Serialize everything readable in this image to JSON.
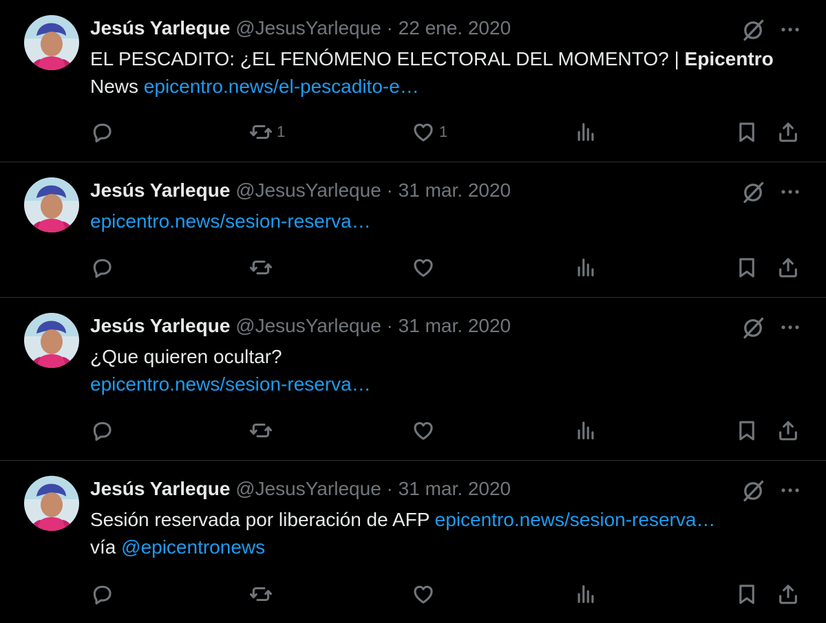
{
  "colors": {
    "background": "#000000",
    "text": "#e7e9ea",
    "muted": "#71767b",
    "link": "#1d9bf0",
    "divider": "#2f3336"
  },
  "icons": {
    "reply": "reply-icon",
    "retweet": "retweet-icon",
    "like": "heart-icon",
    "views": "views-icon",
    "bookmark": "bookmark-icon",
    "share": "share-icon",
    "grok": "grok-icon",
    "more": "more-icon"
  },
  "tweets": [
    {
      "name": "Jesús Yarleque",
      "handle": "@JesusYarleque",
      "sep": "·",
      "date": "22 ene. 2020",
      "text1": "EL PESCADITO: ¿EL FENÓMENO ELECTORAL DEL MOMENTO? | ",
      "bold": "Epicentro",
      "text2": "News ",
      "link": "epicentro.news/el-pescadito-e…",
      "retweets": "1",
      "likes": "1"
    },
    {
      "name": "Jesús Yarleque",
      "handle": "@JesusYarleque",
      "sep": "·",
      "date": "31 mar. 2020",
      "link": "epicentro.news/sesion-reserva…"
    },
    {
      "name": "Jesús Yarleque",
      "handle": "@JesusYarleque",
      "sep": "·",
      "date": "31 mar. 2020",
      "text1": "¿Que quieren ocultar?",
      "link": "epicentro.news/sesion-reserva…"
    },
    {
      "name": "Jesús Yarleque",
      "handle": "@JesusYarleque",
      "sep": "·",
      "date": "31 mar. 2020",
      "text1": "Sesión reservada por liberación de AFP ",
      "link": "epicentro.news/sesion-reserva…",
      "text2": "vía ",
      "mention": "@epicentronews"
    }
  ]
}
